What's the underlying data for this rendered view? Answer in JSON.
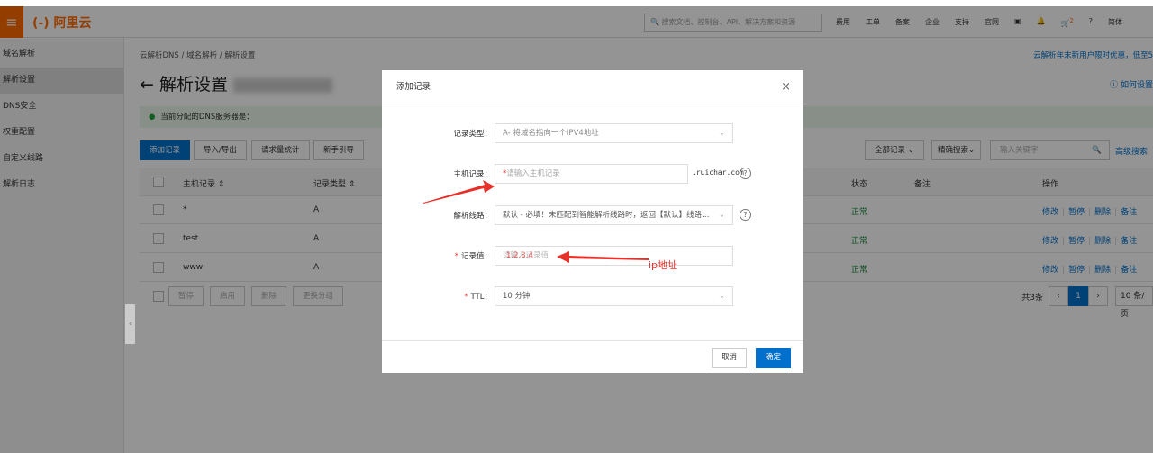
{
  "topbar": {
    "logo": "(-) 阿里云",
    "search_placeholder": "搜索文档、控制台、API、解决方案和资源",
    "links": [
      "费用",
      "工单",
      "备案",
      "企业",
      "支持",
      "官网"
    ],
    "cart_badge": "2",
    "lang": "简体"
  },
  "sidebar": {
    "items": [
      {
        "label": "域名解析",
        "active": false
      },
      {
        "label": "解析设置",
        "active": true
      },
      {
        "label": "DNS安全",
        "active": false
      },
      {
        "label": "权重配置",
        "active": false
      },
      {
        "label": "自定义线路",
        "active": false
      },
      {
        "label": "解析日志",
        "active": false
      }
    ]
  },
  "main": {
    "breadcrumb": "云解析DNS  /  域名解析  /  解析设置",
    "promo": "云解析年末新用户限时优惠，低至5",
    "title": "解析设置",
    "howto": "如何设置",
    "notice": "当前分配的DNS服务器是：",
    "toolbar": {
      "add": "添加记录",
      "import": "导入/导出",
      "stats": "请求量统计",
      "guide": "新手引导",
      "filter": "全部记录",
      "search_mode": "精确搜索",
      "keyword_placeholder": "输入关键字",
      "advanced": "高级搜索"
    },
    "columns": {
      "host": "主机记录 ⇕",
      "type": "记录类型 ⇕",
      "status": "状态",
      "remark": "备注",
      "ops": "操作"
    },
    "rows": [
      {
        "host": "*",
        "type": "A",
        "status": "正常"
      },
      {
        "host": "test",
        "type": "A",
        "status": "正常"
      },
      {
        "host": "www",
        "type": "A",
        "status": "正常"
      }
    ],
    "ops": [
      "修改",
      "暂停",
      "删除",
      "备注"
    ],
    "bulk": [
      "暂停",
      "启用",
      "删除",
      "更换分组"
    ],
    "pager": {
      "total": "共3条",
      "page": "1",
      "size": "10 条/页"
    }
  },
  "modal": {
    "title": "添加记录",
    "close": "×",
    "record_type": {
      "label": "记录类型：",
      "value": "A- 将域名指向一个IPV4地址"
    },
    "host": {
      "label": "主机记录：",
      "placeholder": "请输入主机记录",
      "suffix": ".ruichar.com"
    },
    "line": {
      "label": "解析线路：",
      "value": "默认 - 必填！未匹配到智能解析线路时，返回【默认】线路设..."
    },
    "value": {
      "label": "记录值：",
      "placeholder": "请输入记录值",
      "annotation_text": "1.2.3.4"
    },
    "ttl": {
      "label": "TTL：",
      "value": "10 分钟"
    },
    "cancel": "取消",
    "ok": "确定"
  },
  "annotations": {
    "ip_label": "ip地址",
    "arrow_color": "#e8302a"
  }
}
